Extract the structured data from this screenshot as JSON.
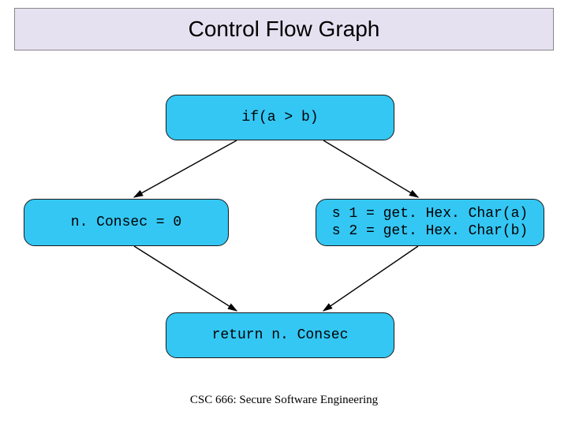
{
  "title": "Control Flow Graph",
  "nodes": {
    "condition": "if(a > b)",
    "left": "n. Consec = 0",
    "right": "s 1 = get. Hex. Char(a)\ns 2 = get. Hex. Char(b)",
    "ret": "return n. Consec"
  },
  "footer": "CSC 666: Secure Software Engineering",
  "colors": {
    "node_fill": "#34c7f4",
    "title_fill": "#e6e1f0"
  }
}
